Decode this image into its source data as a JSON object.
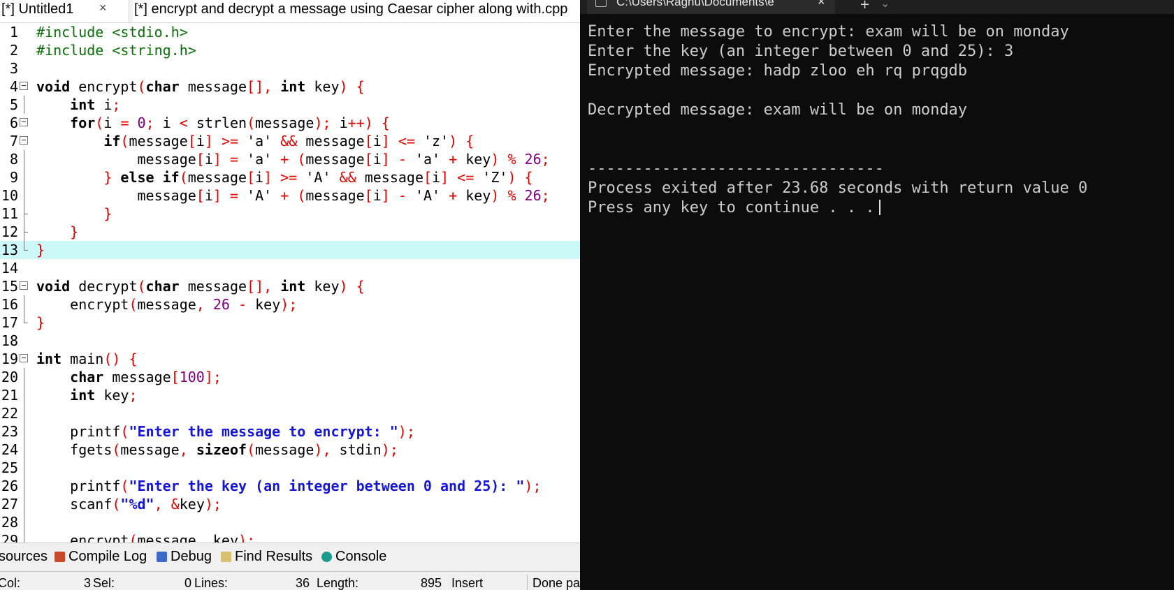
{
  "ide": {
    "tabs": [
      {
        "label": "[*] Untitled1",
        "close": "×"
      },
      {
        "label": "[*] encrypt and decrypt a message using Caesar cipher along with.cpp"
      }
    ],
    "bottom_tabs": [
      "sources",
      "Compile Log",
      "Debug",
      "Find Results",
      "Console"
    ],
    "status": {
      "col": "Col:",
      "col_val": "3",
      "sel": "Sel:",
      "sel_val": "0",
      "lines": "Lines:",
      "lines_val": "36",
      "length": "Length:",
      "length_val": "895",
      "mode": "Insert",
      "done": "Done pa"
    },
    "highlighted_line": 13,
    "code": [
      {
        "n": "1",
        "fold": "none",
        "t": [
          [
            "p",
            "#include <stdio.h>"
          ]
        ]
      },
      {
        "n": "2",
        "fold": "none",
        "t": [
          [
            "p",
            "#include <string.h>"
          ]
        ]
      },
      {
        "n": "3",
        "fold": "none",
        "t": []
      },
      {
        "n": "4",
        "fold": "box",
        "t": [
          [
            "k",
            "void"
          ],
          [
            "ch",
            " encrypt"
          ],
          [
            "o",
            "("
          ],
          [
            "k",
            "char"
          ],
          [
            "ch",
            " message"
          ],
          [
            "o",
            "[],"
          ],
          [
            "ch",
            " "
          ],
          [
            "k",
            "int"
          ],
          [
            "ch",
            " key"
          ],
          [
            "o",
            ")"
          ],
          [
            "ch",
            " "
          ],
          [
            "o",
            "{"
          ]
        ]
      },
      {
        "n": "5",
        "fold": "line",
        "t": [
          [
            "ch",
            "    "
          ],
          [
            "k",
            "int"
          ],
          [
            "ch",
            " i"
          ],
          [
            "o",
            ";"
          ]
        ]
      },
      {
        "n": "6",
        "fold": "box",
        "t": [
          [
            "ch",
            "    "
          ],
          [
            "k",
            "for"
          ],
          [
            "o",
            "("
          ],
          [
            "ch",
            "i "
          ],
          [
            "o",
            "="
          ],
          [
            "ch",
            " "
          ],
          [
            "n",
            "0"
          ],
          [
            "o",
            ";"
          ],
          [
            "ch",
            " i "
          ],
          [
            "o",
            "<"
          ],
          [
            "ch",
            " strlen"
          ],
          [
            "o",
            "("
          ],
          [
            "ch",
            "message"
          ],
          [
            "o",
            ");"
          ],
          [
            "ch",
            " i"
          ],
          [
            "o",
            "++)"
          ],
          [
            "ch",
            " "
          ],
          [
            "o",
            "{"
          ]
        ]
      },
      {
        "n": "7",
        "fold": "box",
        "t": [
          [
            "ch",
            "        "
          ],
          [
            "k",
            "if"
          ],
          [
            "o",
            "("
          ],
          [
            "ch",
            "message"
          ],
          [
            "o",
            "["
          ],
          [
            "ch",
            "i"
          ],
          [
            "o",
            "]"
          ],
          [
            "ch",
            " "
          ],
          [
            "o",
            ">="
          ],
          [
            "ch",
            " 'a' "
          ],
          [
            "o",
            "&&"
          ],
          [
            "ch",
            " message"
          ],
          [
            "o",
            "["
          ],
          [
            "ch",
            "i"
          ],
          [
            "o",
            "]"
          ],
          [
            "ch",
            " "
          ],
          [
            "o",
            "<="
          ],
          [
            "ch",
            " 'z'"
          ],
          [
            "o",
            ")"
          ],
          [
            "ch",
            " "
          ],
          [
            "o",
            "{"
          ]
        ]
      },
      {
        "n": "8",
        "fold": "line",
        "t": [
          [
            "ch",
            "            message"
          ],
          [
            "o",
            "["
          ],
          [
            "ch",
            "i"
          ],
          [
            "o",
            "]"
          ],
          [
            "ch",
            " "
          ],
          [
            "o",
            "="
          ],
          [
            "ch",
            " 'a' "
          ],
          [
            "o",
            "+"
          ],
          [
            "ch",
            " "
          ],
          [
            "o",
            "("
          ],
          [
            "ch",
            "message"
          ],
          [
            "o",
            "["
          ],
          [
            "ch",
            "i"
          ],
          [
            "o",
            "]"
          ],
          [
            "ch",
            " "
          ],
          [
            "o",
            "-"
          ],
          [
            "ch",
            " 'a' "
          ],
          [
            "o",
            "+"
          ],
          [
            "ch",
            " key"
          ],
          [
            "o",
            ")"
          ],
          [
            "ch",
            " "
          ],
          [
            "o",
            "%"
          ],
          [
            "ch",
            " "
          ],
          [
            "n",
            "26"
          ],
          [
            "o",
            ";"
          ]
        ]
      },
      {
        "n": "9",
        "fold": "line",
        "t": [
          [
            "ch",
            "        "
          ],
          [
            "o",
            "}"
          ],
          [
            "ch",
            " "
          ],
          [
            "k",
            "else if"
          ],
          [
            "o",
            "("
          ],
          [
            "ch",
            "message"
          ],
          [
            "o",
            "["
          ],
          [
            "ch",
            "i"
          ],
          [
            "o",
            "]"
          ],
          [
            "ch",
            " "
          ],
          [
            "o",
            ">="
          ],
          [
            "ch",
            " 'A' "
          ],
          [
            "o",
            "&&"
          ],
          [
            "ch",
            " message"
          ],
          [
            "o",
            "["
          ],
          [
            "ch",
            "i"
          ],
          [
            "o",
            "]"
          ],
          [
            "ch",
            " "
          ],
          [
            "o",
            "<="
          ],
          [
            "ch",
            " 'Z'"
          ],
          [
            "o",
            ")"
          ],
          [
            "ch",
            " "
          ],
          [
            "o",
            "{"
          ]
        ]
      },
      {
        "n": "10",
        "fold": "line",
        "t": [
          [
            "ch",
            "            message"
          ],
          [
            "o",
            "["
          ],
          [
            "ch",
            "i"
          ],
          [
            "o",
            "]"
          ],
          [
            "ch",
            " "
          ],
          [
            "o",
            "="
          ],
          [
            "ch",
            " 'A' "
          ],
          [
            "o",
            "+"
          ],
          [
            "ch",
            " "
          ],
          [
            "o",
            "("
          ],
          [
            "ch",
            "message"
          ],
          [
            "o",
            "["
          ],
          [
            "ch",
            "i"
          ],
          [
            "o",
            "]"
          ],
          [
            "ch",
            " "
          ],
          [
            "o",
            "-"
          ],
          [
            "ch",
            " 'A' "
          ],
          [
            "o",
            "+"
          ],
          [
            "ch",
            " key"
          ],
          [
            "o",
            ")"
          ],
          [
            "ch",
            " "
          ],
          [
            "o",
            "%"
          ],
          [
            "ch",
            " "
          ],
          [
            "n",
            "26"
          ],
          [
            "o",
            ";"
          ]
        ]
      },
      {
        "n": "11",
        "fold": "mid",
        "t": [
          [
            "ch",
            "        "
          ],
          [
            "o",
            "}"
          ]
        ]
      },
      {
        "n": "12",
        "fold": "mid",
        "t": [
          [
            "ch",
            "    "
          ],
          [
            "o",
            "}"
          ]
        ]
      },
      {
        "n": "13",
        "fold": "end",
        "t": [
          [
            "o",
            "}"
          ]
        ]
      },
      {
        "n": "14",
        "fold": "none",
        "t": []
      },
      {
        "n": "15",
        "fold": "box",
        "t": [
          [
            "k",
            "void"
          ],
          [
            "ch",
            " decrypt"
          ],
          [
            "o",
            "("
          ],
          [
            "k",
            "char"
          ],
          [
            "ch",
            " message"
          ],
          [
            "o",
            "[],"
          ],
          [
            "ch",
            " "
          ],
          [
            "k",
            "int"
          ],
          [
            "ch",
            " key"
          ],
          [
            "o",
            ")"
          ],
          [
            "ch",
            " "
          ],
          [
            "o",
            "{"
          ]
        ]
      },
      {
        "n": "16",
        "fold": "line",
        "t": [
          [
            "ch",
            "    encrypt"
          ],
          [
            "o",
            "("
          ],
          [
            "ch",
            "message"
          ],
          [
            "o",
            ","
          ],
          [
            "ch",
            " "
          ],
          [
            "n",
            "26"
          ],
          [
            "ch",
            " "
          ],
          [
            "o",
            "-"
          ],
          [
            "ch",
            " key"
          ],
          [
            "o",
            ");"
          ]
        ]
      },
      {
        "n": "17",
        "fold": "end",
        "t": [
          [
            "o",
            "}"
          ]
        ]
      },
      {
        "n": "18",
        "fold": "none",
        "t": []
      },
      {
        "n": "19",
        "fold": "box",
        "t": [
          [
            "k",
            "int"
          ],
          [
            "ch",
            " main"
          ],
          [
            "o",
            "()"
          ],
          [
            "ch",
            " "
          ],
          [
            "o",
            "{"
          ]
        ]
      },
      {
        "n": "20",
        "fold": "line",
        "t": [
          [
            "ch",
            "    "
          ],
          [
            "k",
            "char"
          ],
          [
            "ch",
            " message"
          ],
          [
            "o",
            "["
          ],
          [
            "n",
            "100"
          ],
          [
            "o",
            "];"
          ]
        ]
      },
      {
        "n": "21",
        "fold": "line",
        "t": [
          [
            "ch",
            "    "
          ],
          [
            "k",
            "int"
          ],
          [
            "ch",
            " key"
          ],
          [
            "o",
            ";"
          ]
        ]
      },
      {
        "n": "22",
        "fold": "line",
        "t": []
      },
      {
        "n": "23",
        "fold": "line",
        "t": [
          [
            "ch",
            "    printf"
          ],
          [
            "o",
            "("
          ],
          [
            "s",
            "\"Enter the message to encrypt: \""
          ],
          [
            "o",
            ");"
          ]
        ]
      },
      {
        "n": "24",
        "fold": "line",
        "t": [
          [
            "ch",
            "    fgets"
          ],
          [
            "o",
            "("
          ],
          [
            "ch",
            "message"
          ],
          [
            "o",
            ","
          ],
          [
            "ch",
            " "
          ],
          [
            "k",
            "sizeof"
          ],
          [
            "o",
            "("
          ],
          [
            "ch",
            "message"
          ],
          [
            "o",
            "),"
          ],
          [
            "ch",
            " stdin"
          ],
          [
            "o",
            ");"
          ]
        ]
      },
      {
        "n": "25",
        "fold": "line",
        "t": []
      },
      {
        "n": "26",
        "fold": "line",
        "t": [
          [
            "ch",
            "    printf"
          ],
          [
            "o",
            "("
          ],
          [
            "s",
            "\"Enter the key (an integer between 0 and 25): \""
          ],
          [
            "o",
            ");"
          ]
        ]
      },
      {
        "n": "27",
        "fold": "line",
        "t": [
          [
            "ch",
            "    scanf"
          ],
          [
            "o",
            "("
          ],
          [
            "s",
            "\"%d\""
          ],
          [
            "o",
            ","
          ],
          [
            "ch",
            " "
          ],
          [
            "o",
            "&"
          ],
          [
            "ch",
            "key"
          ],
          [
            "o",
            ");"
          ]
        ]
      },
      {
        "n": "28",
        "fold": "line",
        "t": []
      },
      {
        "n": "29",
        "fold": "line",
        "t": [
          [
            "ch",
            "    encrypt"
          ],
          [
            "o",
            "("
          ],
          [
            "ch",
            "message"
          ],
          [
            "o",
            ","
          ],
          [
            "ch",
            " key"
          ],
          [
            "o",
            ");"
          ]
        ]
      }
    ]
  },
  "terminal": {
    "tab_title": "C:\\Users\\Raghu\\Documents\\e",
    "tab_close": "×",
    "new_tab": "+",
    "dropdown": "⌄",
    "lines": [
      "Enter the message to encrypt: exam will be on monday",
      "Enter the key (an integer between 0 and 25): 3",
      "Encrypted message: hadp zloo eh rq prqgdb",
      "",
      "Decrypted message: exam will be on monday",
      "",
      "",
      "--------------------------------",
      "Process exited after 23.68 seconds with return value 0",
      "Press any key to continue . . ."
    ]
  }
}
